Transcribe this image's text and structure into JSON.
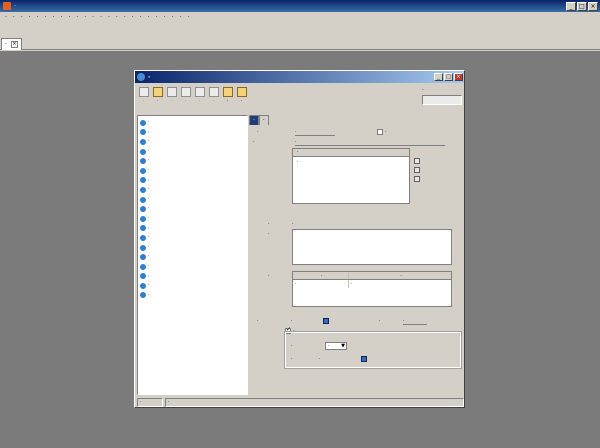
{
  "app": {
    "title": "·"
  },
  "menu": [
    "·",
    "·",
    "·",
    "·",
    "·",
    "·",
    "·",
    "·",
    "·",
    "·",
    "·",
    "·",
    "·",
    "·",
    "·",
    "·",
    "·",
    "·",
    "·",
    "·",
    "·",
    "·",
    "·",
    "·"
  ],
  "tabs": [
    {
      "label": "·"
    }
  ],
  "dialog": {
    "title": "·",
    "toolbar": [
      {
        "label": "·",
        "enabled": false,
        "icon": "new-icon"
      },
      {
        "label": "·",
        "enabled": true,
        "icon": "edit-icon"
      },
      {
        "label": "·",
        "enabled": false,
        "icon": "delete-icon"
      },
      {
        "label": "·",
        "enabled": false,
        "icon": "save-icon"
      },
      {
        "label": "·",
        "enabled": false,
        "icon": "undo-icon"
      },
      {
        "label": "·",
        "enabled": false,
        "icon": "refresh-icon"
      },
      {
        "label": "·",
        "enabled": true,
        "icon": "attachment-icon"
      },
      {
        "label": "·",
        "enabled": true,
        "icon": "tools-icon"
      }
    ],
    "search_label": "·",
    "search_value": "",
    "tree_items": [
      "·",
      "·",
      "·",
      "·",
      "·",
      "·",
      "·",
      "·",
      "·",
      "·",
      "·",
      "·",
      "·",
      "·",
      "·",
      "·",
      "·",
      "·",
      "·"
    ],
    "form_tabs": [
      "·",
      "·"
    ],
    "fields": {
      "event_code_label": "·",
      "event_code": "·",
      "enabled_label": "·",
      "prompt_name_label": "·",
      "prompt_name": "·",
      "recipients_header": "·",
      "recipients": "·",
      "msg_title_label": "·",
      "msg_title": "·",
      "msg_content_label": "·",
      "condition_label": "·",
      "condition_col1": "·",
      "condition_col2": "·",
      "condition_row_name": "·",
      "condition_row_value": "·",
      "start_date_label": "·",
      "start_date": "·",
      "remind_time_label": "·",
      "remind_time": "·",
      "cycle_label": "·",
      "cycle_mode_label": "·",
      "cycle_mode": "·",
      "end_date_label": "·",
      "end_date": "·"
    },
    "status": {
      "left": "·",
      "right": "·"
    }
  },
  "colors": {
    "titlebar": "#0a246a",
    "active_tab": "#1f3f7a",
    "workspace": "#7b7b7b",
    "tree_icon": "#2f7fd0"
  }
}
